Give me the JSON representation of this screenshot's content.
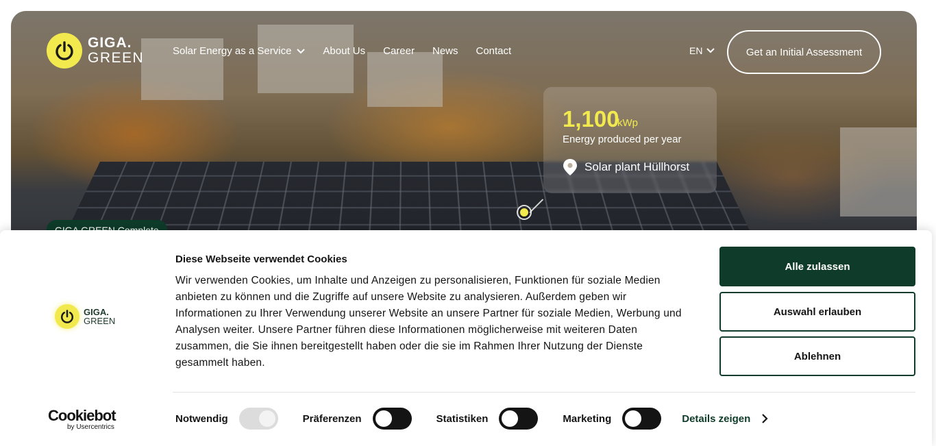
{
  "header": {
    "logo": {
      "line1": "GIGA.",
      "line2": "GREEN"
    },
    "nav": [
      {
        "label": "Solar Energy as a Service",
        "has_dropdown": true
      },
      {
        "label": "About Us"
      },
      {
        "label": "Career"
      },
      {
        "label": "News"
      },
      {
        "label": "Contact"
      }
    ],
    "language": "EN",
    "cta_label": "Get an Initial Assessment"
  },
  "hero": {
    "stat_value": "1,100",
    "stat_unit": "kWp",
    "stat_label": "Energy produced per year",
    "location": "Solar plant Hüllhorst",
    "badge": "GIGA GREEN Complete"
  },
  "cookie_banner": {
    "logo": {
      "line1": "GIGA.",
      "line2": "GREEN"
    },
    "title": "Diese Webseite verwendet Cookies",
    "text": "Wir verwenden Cookies, um Inhalte und Anzeigen zu personalisieren, Funktionen für soziale Medien anbieten zu können und die Zugriffe auf unsere Website zu analysieren. Außerdem geben wir Informationen zu Ihrer Verwendung unserer Website an unsere Partner für soziale Medien, Werbung und Analysen weiter. Unsere Partner führen diese Informationen möglicherweise mit weiteren Daten zusammen, die Sie ihnen bereitgestellt haben oder die sie im Rahmen Ihrer Nutzung der Dienste gesammelt haben.",
    "buttons": {
      "allow_all": "Alle zulassen",
      "allow_selection": "Auswahl erlauben",
      "deny": "Ablehnen"
    },
    "toggles": [
      {
        "label": "Notwendig",
        "state": "on-disabled"
      },
      {
        "label": "Präferenzen",
        "state": "off"
      },
      {
        "label": "Statistiken",
        "state": "off"
      },
      {
        "label": "Marketing",
        "state": "off"
      }
    ],
    "details_label": "Details zeigen",
    "cookiebot": {
      "brand": "Cookiebot",
      "sub": "by Usercentrics"
    }
  },
  "colors": {
    "brand_yellow": "#f2e94e",
    "brand_dark_green": "#0e3b2a"
  }
}
